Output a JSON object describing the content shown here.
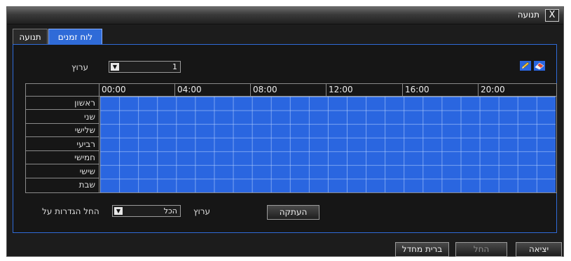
{
  "window": {
    "title": "תנועה",
    "close_label": "X"
  },
  "tabs": [
    {
      "label": "לוח זמנים",
      "active": true
    },
    {
      "label": "תנועה",
      "active": false
    }
  ],
  "schedule": {
    "channel_label": "ערוץ",
    "channel_value": "1",
    "hours": [
      "00:00",
      "04:00",
      "08:00",
      "12:00",
      "16:00",
      "20:00"
    ],
    "days": [
      "ראשון",
      "שני",
      "שלישי",
      "רביעי",
      "חמישי",
      "שישי",
      "שבת"
    ],
    "slot_color": "#2a66e0",
    "tools": [
      "pencil-icon",
      "eraser-icon"
    ]
  },
  "apply": {
    "label": "החל הגדרות על",
    "select_value": "הכל",
    "channel_label": "ערוץ",
    "copy_button": "העתקה"
  },
  "footer": {
    "default_button": "ברית מחדל",
    "apply_button": "החל",
    "exit_button": "יציאה"
  }
}
